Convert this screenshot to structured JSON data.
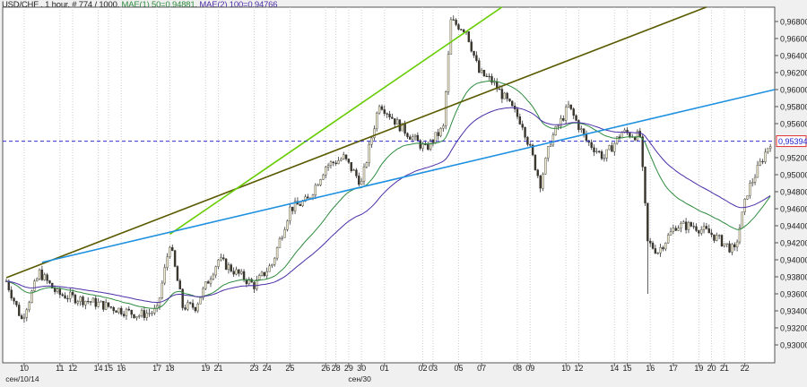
{
  "header": {
    "symbol": "USD/CHF",
    "info": " , 1 hour, # 774 / 1000, ",
    "ma1": "MAE(1) 50=0,94881",
    "sep": ", ",
    "ma2": "MAE(2) 100=0,94766"
  },
  "chart_data": {
    "type": "candlestick",
    "title": "USD/CHF , 1 hour",
    "bars": 300,
    "ylim": [
      0.929,
      0.9698
    ],
    "y_ticks": [
      "0,96800",
      "0,96600",
      "0,96400",
      "0,96200",
      "0,96000",
      "0,95800",
      "0,95600",
      "0,95200",
      "0,95000",
      "0,94800",
      "0,94600",
      "0,94400",
      "0,94200",
      "0,94000",
      "0,93800",
      "0,93600",
      "0,93400",
      "0,93200",
      "0,93000"
    ],
    "y_tick_values": [
      0.968,
      0.966,
      0.964,
      0.962,
      0.96,
      0.958,
      0.956,
      0.952,
      0.95,
      0.948,
      0.946,
      0.944,
      0.942,
      0.94,
      0.938,
      0.936,
      0.934,
      0.932,
      0.93
    ],
    "current_price": {
      "label": "0,95394",
      "value": 0.95394
    },
    "x_labels": [
      [
        "10",
        7
      ],
      [
        "11",
        21
      ],
      [
        "12",
        26
      ],
      [
        "14",
        36
      ],
      [
        "15",
        40
      ],
      [
        "16",
        45
      ],
      [
        "17",
        59
      ],
      [
        "18",
        64
      ],
      [
        "19",
        78
      ],
      [
        "21",
        83
      ],
      [
        "23",
        97
      ],
      [
        "24",
        102
      ],
      [
        "25",
        111
      ],
      [
        "26",
        125
      ],
      [
        "28",
        129
      ],
      [
        "29",
        134
      ],
      [
        "30",
        139
      ],
      [
        "01",
        148
      ],
      [
        "02",
        163
      ],
      [
        "03",
        167
      ],
      [
        "05",
        177
      ],
      [
        "07",
        186
      ],
      [
        "08",
        200
      ],
      [
        "09",
        205
      ],
      [
        "10",
        219
      ],
      [
        "12",
        224
      ],
      [
        "14",
        238
      ],
      [
        "15",
        243
      ],
      [
        "16",
        252
      ],
      [
        "17",
        261
      ],
      [
        "19",
        271
      ],
      [
        "20",
        276
      ],
      [
        "21",
        281
      ],
      [
        "22",
        289
      ]
    ],
    "x_sublabels": [
      [
        "сен/10/14",
        7
      ],
      [
        "сен/30",
        139
      ]
    ],
    "price_path": [
      [
        0,
        0.9375
      ],
      [
        6,
        0.933
      ],
      [
        13,
        0.9385
      ],
      [
        20,
        0.936
      ],
      [
        34,
        0.935
      ],
      [
        52,
        0.9335
      ],
      [
        59,
        0.934
      ],
      [
        64,
        0.942
      ],
      [
        69,
        0.9345
      ],
      [
        74,
        0.9345
      ],
      [
        83,
        0.94
      ],
      [
        97,
        0.937
      ],
      [
        104,
        0.9395
      ],
      [
        111,
        0.946
      ],
      [
        118,
        0.947
      ],
      [
        125,
        0.951
      ],
      [
        132,
        0.952
      ],
      [
        139,
        0.949
      ],
      [
        146,
        0.9585
      ],
      [
        153,
        0.956
      ],
      [
        164,
        0.953
      ],
      [
        171,
        0.9555
      ],
      [
        174,
        0.968
      ],
      [
        180,
        0.967
      ],
      [
        185,
        0.962
      ],
      [
        190,
        0.961
      ],
      [
        195,
        0.959
      ],
      [
        202,
        0.956
      ],
      [
        209,
        0.949
      ],
      [
        213,
        0.954
      ],
      [
        220,
        0.958
      ],
      [
        227,
        0.954
      ],
      [
        234,
        0.952
      ],
      [
        241,
        0.955
      ],
      [
        248,
        0.9545
      ],
      [
        251,
        0.942
      ],
      [
        255,
        0.941
      ],
      [
        262,
        0.944
      ],
      [
        269,
        0.944
      ],
      [
        276,
        0.943
      ],
      [
        285,
        0.941
      ],
      [
        290,
        0.948
      ],
      [
        299,
        0.9539
      ]
    ],
    "spike": {
      "bar": 251,
      "low": 0.936
    },
    "series": [
      {
        "name": "MAE(1) 50",
        "value": 0.94881,
        "color": "#2e8b3e",
        "period": 50
      },
      {
        "name": "MAE(2) 100",
        "value": 0.94766,
        "color": "#4b2ea8",
        "period": 100
      }
    ],
    "trendlines": [
      {
        "name": "olive",
        "color": "#5a5a00",
        "from": [
          0,
          0.9379
        ],
        "to": [
          274,
          0.9697
        ]
      },
      {
        "name": "green",
        "color": "#66cc00",
        "from": [
          64,
          0.943
        ],
        "to": [
          194,
          0.9697
        ]
      },
      {
        "name": "blue",
        "color": "#1e90e0",
        "from": [
          14,
          0.9397
        ],
        "to": [
          312,
          0.9608
        ]
      }
    ]
  }
}
